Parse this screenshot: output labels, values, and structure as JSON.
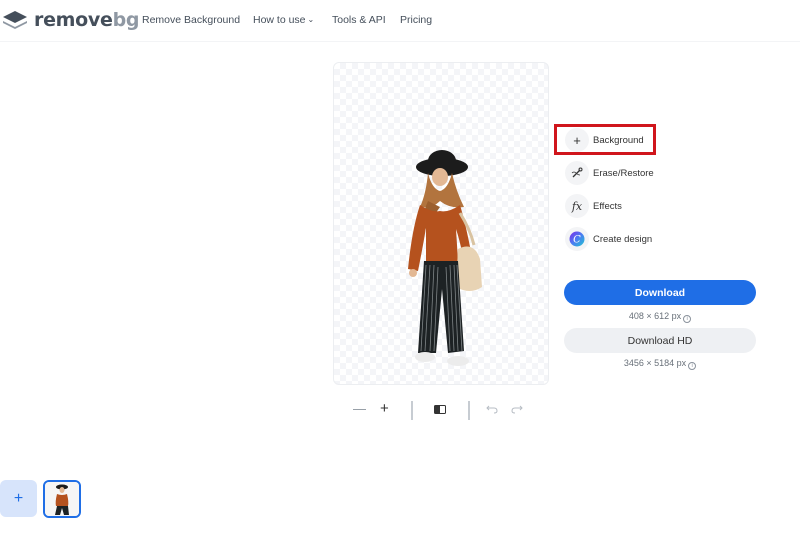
{
  "brand": {
    "name_main": "remove",
    "name_accent": "bg"
  },
  "nav": {
    "items": [
      {
        "label": "Remove Background"
      },
      {
        "label": "How to use",
        "has_dropdown": true
      },
      {
        "label": "Tools & API"
      },
      {
        "label": "Pricing"
      }
    ]
  },
  "editor": {
    "tools": [
      {
        "label": "Background",
        "icon": "plus-icon",
        "highlighted": true
      },
      {
        "label": "Erase/Restore",
        "icon": "brush-icon"
      },
      {
        "label": "Effects",
        "icon": "fx-icon"
      },
      {
        "label": "Create design",
        "icon": "canva-icon"
      }
    ],
    "download": {
      "label": "Download",
      "size": "408 × 612 px"
    },
    "download_hd": {
      "label": "Download HD",
      "size": "3456 × 5184 px"
    },
    "controls": {
      "zoom_out": "zoom-out-icon",
      "zoom_in": "zoom-in-icon",
      "compare": "compare-icon",
      "undo": "undo-icon",
      "redo": "redo-icon"
    }
  },
  "colors": {
    "accent": "#1f6ee6",
    "highlight": "#d0151c",
    "add_tile": "#d7e4fb"
  }
}
